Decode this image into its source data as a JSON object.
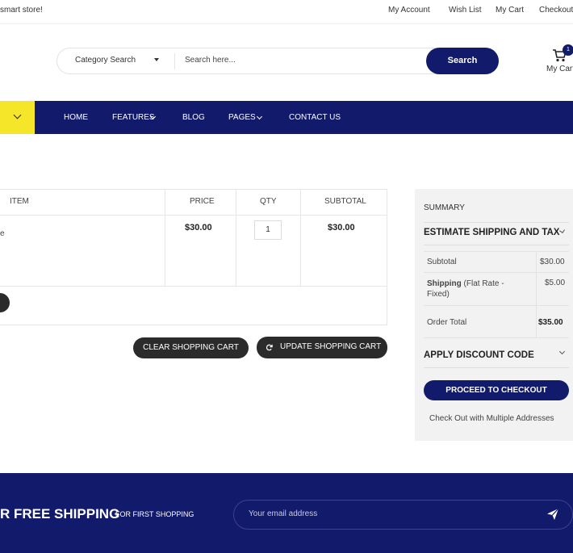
{
  "topbar": {
    "welcome": "smart store!",
    "links": [
      "My Account",
      "Wish List",
      "My Cart",
      "Checkout"
    ]
  },
  "header": {
    "category_label": "Category Search",
    "search_placeholder": "Search here...",
    "search_button": "Search",
    "cart_count": "1",
    "cart_label": "My Cart"
  },
  "nav": {
    "items": [
      "HOME",
      "FEATURES",
      "BLOG",
      "PAGES",
      "CONTACT US"
    ]
  },
  "cart": {
    "headers": {
      "item": "ITEM",
      "price": "PRICE",
      "qty": "QTY",
      "subtotal": "SUBTOTAL"
    },
    "row": {
      "item_fragment": "e",
      "price": "$30.00",
      "qty": "1",
      "subtotal": "$30.00"
    },
    "clear_button": "CLEAR SHOPPING CART",
    "update_button": "UPDATE SHOPPING CART"
  },
  "summary": {
    "title": "SUMMARY",
    "estimate_heading": "ESTIMATE SHIPPING AND TAX",
    "subtotal_label": "Subtotal",
    "subtotal_value": "$30.00",
    "shipping_label": "Shipping",
    "shipping_method": " (Flat Rate - Fixed)",
    "shipping_value": "$5.00",
    "order_total_label": "Order Total",
    "order_total_value": "$35.00",
    "discount_heading": "APPLY DISCOUNT CODE",
    "checkout_button": "PROCEED TO CHECKOUT",
    "multi_address": "Check Out with Multiple Addresses"
  },
  "footer": {
    "promo_big": "R FREE SHIPPING",
    "promo_small": "FOR FIRST SHOPPING",
    "email_placeholder": "Your email address"
  },
  "colors": {
    "brand": "#121a6b",
    "accent": "#f6e629",
    "button_dark": "#2b2b2b"
  },
  "icons": [
    "cart-icon",
    "chevron-down-icon",
    "refresh-icon",
    "send-icon"
  ]
}
